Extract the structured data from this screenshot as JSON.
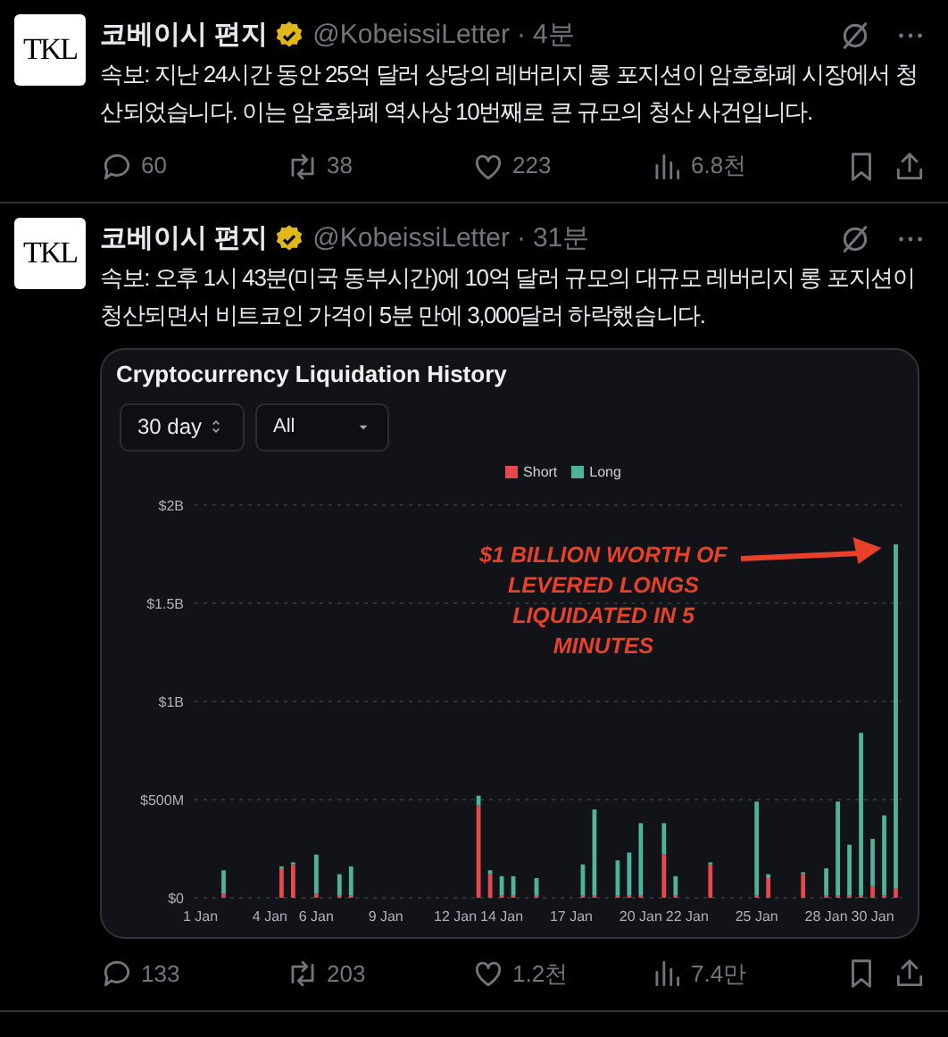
{
  "tweets": [
    {
      "author": {
        "avatar_text": "TKL",
        "name": "코베이시 편지",
        "verified": true,
        "handle": "@KobeissiLetter",
        "dot": "·",
        "time": "4분"
      },
      "text": "속보: 지난 24시간 동안 25억 달러 상당의 레버리지 롱 포지션이 암호화폐 시장에서 청산되었습니다. 이는 암호화폐 역사상 10번째로 큰 규모의 청산 사건입니다.",
      "actions": {
        "replies": "60",
        "reposts": "38",
        "likes": "223",
        "views": "6.8천"
      }
    },
    {
      "author": {
        "avatar_text": "TKL",
        "name": "코베이시 편지",
        "verified": true,
        "handle": "@KobeissiLetter",
        "dot": "·",
        "time": "31분"
      },
      "text": "속보: 오후 1시 43분(미국 동부시간)에 10억 달러 규모의 대규모 레버리지 롱 포지션이 청산되면서 비트코인 가격이 5분 만에 3,000달러 하락했습니다.",
      "media": {
        "controls": [
          {
            "kind": "stepper",
            "label": "30 day"
          },
          {
            "kind": "dropdown",
            "label": "All"
          }
        ],
        "chart_data": {
          "type": "bar",
          "title": "Cryptocurrency Liquidation History",
          "stacked": true,
          "categories": [
            "1 Jan",
            null,
            null,
            null,
            null,
            null,
            "4 Jan",
            null,
            null,
            null,
            "6 Jan",
            null,
            null,
            null,
            null,
            null,
            "9 Jan",
            null,
            null,
            null,
            null,
            null,
            "12 Jan",
            null,
            null,
            null,
            "14 Jan",
            null,
            null,
            null,
            null,
            null,
            "17 Jan",
            null,
            null,
            null,
            null,
            null,
            "20 Jan",
            null,
            null,
            null,
            "22 Jan",
            null,
            null,
            null,
            null,
            null,
            "25 Jan",
            null,
            null,
            null,
            null,
            null,
            "28 Jan",
            null,
            null,
            null,
            "30 Jan",
            null,
            null
          ],
          "series": [
            {
              "name": "Short",
              "color": "#e5484d",
              "values": [
                null,
                null,
                20000000,
                null,
                null,
                null,
                null,
                150000000,
                170000000,
                null,
                20000000,
                null,
                10000000,
                10000000,
                null,
                null,
                null,
                null,
                null,
                null,
                null,
                null,
                null,
                null,
                470000000,
                120000000,
                10000000,
                10000000,
                null,
                10000000,
                null,
                null,
                null,
                10000000,
                10000000,
                null,
                10000000,
                10000000,
                10000000,
                null,
                220000000,
                10000000,
                null,
                null,
                170000000,
                null,
                null,
                null,
                10000000,
                100000000,
                null,
                null,
                120000000,
                null,
                10000000,
                10000000,
                10000000,
                10000000,
                60000000,
                10000000,
                50000000
              ]
            },
            {
              "name": "Long",
              "color": "#4fb39a",
              "values": [
                null,
                null,
                120000000,
                null,
                null,
                null,
                null,
                10000000,
                10000000,
                null,
                200000000,
                null,
                110000000,
                150000000,
                null,
                null,
                null,
                null,
                null,
                null,
                null,
                null,
                null,
                null,
                50000000,
                20000000,
                100000000,
                100000000,
                null,
                90000000,
                null,
                null,
                null,
                160000000,
                440000000,
                null,
                180000000,
                220000000,
                370000000,
                null,
                160000000,
                100000000,
                null,
                null,
                10000000,
                null,
                null,
                null,
                480000000,
                20000000,
                null,
                null,
                10000000,
                null,
                140000000,
                480000000,
                260000000,
                830000000,
                240000000,
                410000000,
                1750000000
              ]
            }
          ],
          "grid": true,
          "ylim": [
            0,
            2000000000
          ],
          "yticks": [
            {
              "value": 0,
              "label": "$0"
            },
            {
              "value": 500000000,
              "label": "$500M"
            },
            {
              "value": 1000000000,
              "label": "$1B"
            },
            {
              "value": 1500000000,
              "label": "$1.5B"
            },
            {
              "value": 2000000000,
              "label": "$2B"
            }
          ],
          "annotations": [
            {
              "text": "$1 BILLION WORTH OF LEVERED LONGS LIQUIDATED IN 5 MINUTES"
            }
          ]
        }
      },
      "actions": {
        "replies": "133",
        "reposts": "203",
        "likes": "1.2천",
        "views": "7.4만"
      }
    }
  ]
}
